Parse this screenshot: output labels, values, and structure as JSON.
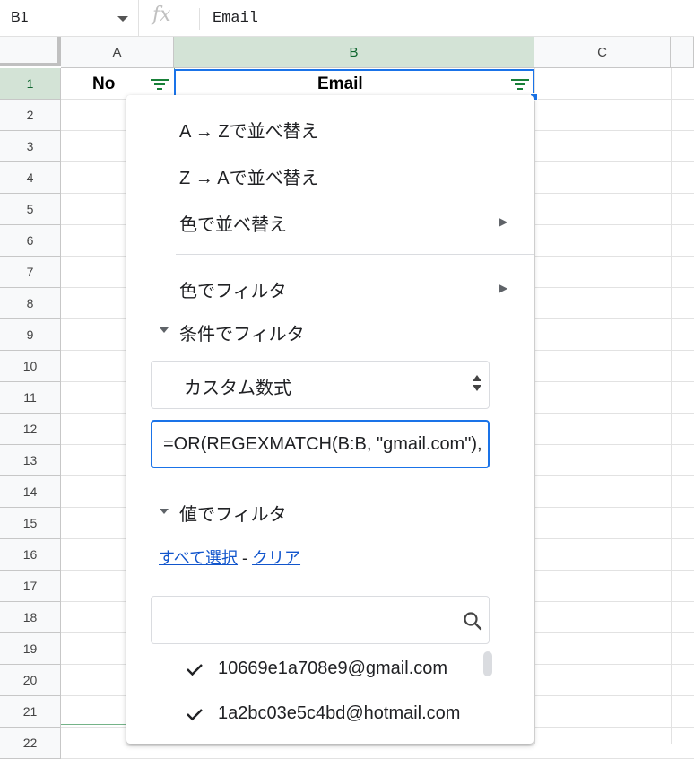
{
  "formula_bar": {
    "cell_ref": "B1",
    "fx_label": "fx",
    "content": "Email"
  },
  "columns": [
    "A",
    "B",
    "C"
  ],
  "rows": [
    "1",
    "2",
    "3",
    "4",
    "5",
    "6",
    "7",
    "8",
    "9",
    "10",
    "11",
    "12",
    "13",
    "14",
    "15",
    "16",
    "17",
    "18",
    "19",
    "20",
    "21",
    "22"
  ],
  "cells": {
    "A1": "No",
    "B1": "Email"
  },
  "filter_menu": {
    "sort_az": "A → Zで並べ替え",
    "sort_za": "Z → Aで並べ替え",
    "sort_by_color": "色で並べ替え",
    "filter_by_color": "色でフィルタ",
    "filter_by_condition": "条件でフィルタ",
    "condition_select": "カスタム数式",
    "condition_formula": "=OR(REGEXMATCH(B:B, \"gmail.com\"), REGEXMATCH(B:B, \"hotmail.com\"))",
    "filter_by_values": "値でフィルタ",
    "select_all": "すべて選択",
    "link_separator": " - ",
    "clear": "クリア",
    "search_placeholder": "",
    "values": [
      {
        "label": "10669e1a708e9@gmail.com",
        "checked": true
      },
      {
        "label": "1a2bc03e5c4bd@hotmail.com",
        "checked": true
      }
    ]
  },
  "colors": {
    "accent_blue": "#1a73e8",
    "filter_green": "#188038",
    "selected_header": "#d3e3d6"
  }
}
